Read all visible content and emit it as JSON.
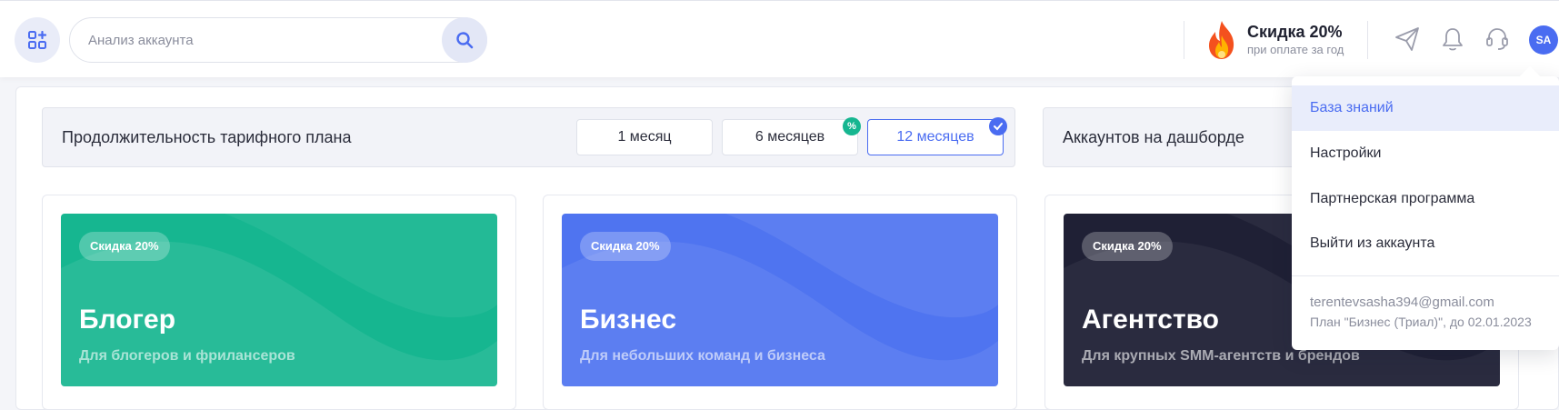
{
  "header": {
    "apps_icon": "apps-grid-icon",
    "search_placeholder": "Анализ аккаунта",
    "search_icon": "search-icon",
    "promo_title": "Скидка 20%",
    "promo_subtitle": "при оплате за год",
    "promo_icon": "fire-icon",
    "icons": [
      "send-icon",
      "bell-icon",
      "support-icon"
    ],
    "avatar_initials": "SA"
  },
  "duration": {
    "label": "Продолжительность тарифного плана",
    "options": [
      "1 месяц",
      "6 месяцев",
      "12 месяцев"
    ],
    "selected": "12 месяцев"
  },
  "accounts": {
    "label": "Аккаунтов на дашборде"
  },
  "plans": [
    {
      "badge": "Скидка 20%",
      "title": "Блогер",
      "subtitle": "Для блогеров и фрилансеров",
      "color": "#16b690"
    },
    {
      "badge": "Скидка 20%",
      "title": "Бизнес",
      "subtitle": "Для небольших команд и бизнеса",
      "color": "#4f74f0"
    },
    {
      "badge": "Скидка 20%",
      "title": "Агентство",
      "subtitle": "Для крупных SMM-агентств и брендов",
      "color": "#1f2035"
    }
  ],
  "menu": {
    "items": [
      "База знаний",
      "Настройки",
      "Партнерская программа",
      "Выйти из аккаунта"
    ],
    "active": "База знаний",
    "email": "terentevsasha394@gmail.com",
    "plan": "План \"Бизнес (Триал)\", до 02.01.2023"
  },
  "colors": {
    "accent": "#4a6cf1",
    "green_badge": "#16b690"
  }
}
